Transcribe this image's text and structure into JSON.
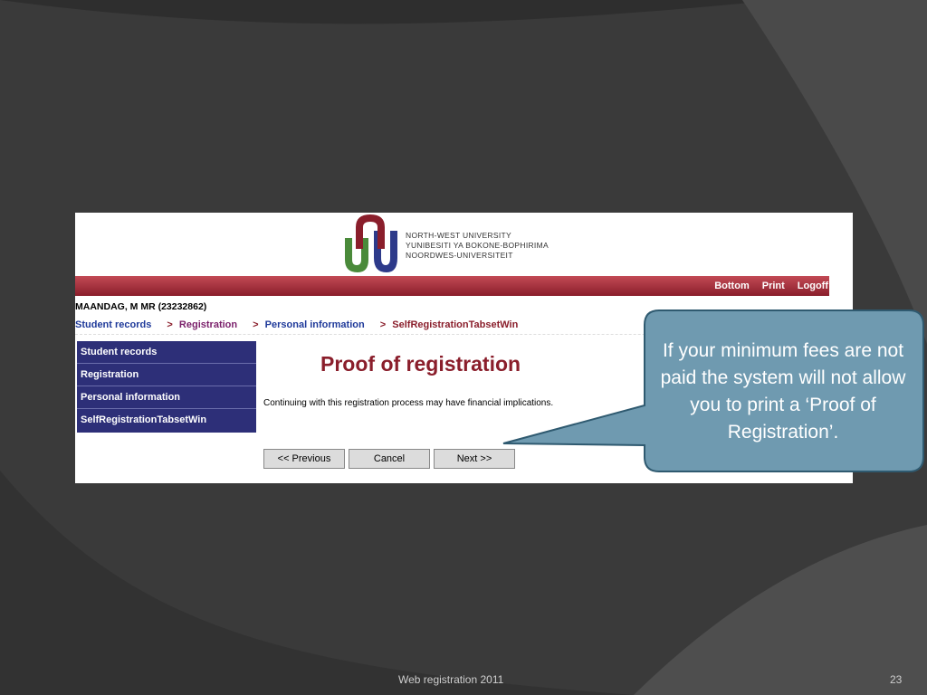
{
  "university": {
    "lines": [
      "NORTH-WEST UNIVERSITY",
      "YUNIBESITI YA BOKONE-BOPHIRIMA",
      "NOORDWES-UNIVERSITEIT"
    ],
    "colors": {
      "maroon": "#8a1e2b",
      "green": "#4a8a3a",
      "blue": "#2d3a8a"
    }
  },
  "topmenu": {
    "bottom": "Bottom",
    "print": "Print",
    "logoff": "Logoff"
  },
  "user": {
    "name": "MAANDAG, M MR (23232862)"
  },
  "breadcrumb": {
    "items": [
      "Student records",
      "Registration",
      "Personal information",
      "SelfRegistrationTabsetWin"
    ],
    "separator": ">"
  },
  "sidebar": {
    "items": [
      "Student records",
      "Registration",
      "Personal information",
      "SelfRegistrationTabsetWin"
    ]
  },
  "main": {
    "title": "Proof of registration",
    "warning": "Continuing with this registration process may have financial implications.",
    "buttons": {
      "previous": "<< Previous",
      "cancel": "Cancel",
      "next": "Next >>"
    }
  },
  "callout": {
    "text": "If your minimum fees are not paid the system will not allow you to print a ‘Proof of Registration’."
  },
  "footer": {
    "title": "Web registration 2011",
    "page": "23"
  }
}
